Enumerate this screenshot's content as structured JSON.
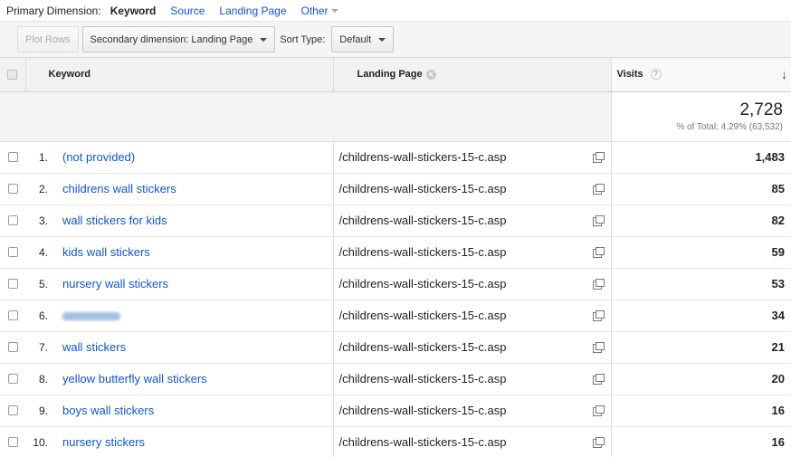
{
  "primary_dimension": {
    "label": "Primary Dimension:",
    "items": [
      {
        "label": "Keyword",
        "active": true
      },
      {
        "label": "Source",
        "active": false
      },
      {
        "label": "Landing Page",
        "active": false
      },
      {
        "label": "Other",
        "active": false
      }
    ]
  },
  "toolbar": {
    "plot_rows": "Plot Rows",
    "secondary_dimension": "Secondary dimension: Landing Page",
    "sort_type_label": "Sort Type:",
    "sort_type_value": "Default"
  },
  "table": {
    "headers": {
      "keyword": "Keyword",
      "landing_page": "Landing Page",
      "visits": "Visits"
    },
    "total": {
      "value": "2,728",
      "pct": "% of Total: 4.29% (63,532)"
    },
    "rows": [
      {
        "idx": "1.",
        "keyword": "(not provided)",
        "landing": "/childrens-wall-stickers-15-c.asp",
        "visits": "1,483"
      },
      {
        "idx": "2.",
        "keyword": "childrens wall stickers",
        "landing": "/childrens-wall-stickers-15-c.asp",
        "visits": "85"
      },
      {
        "idx": "3.",
        "keyword": "wall stickers for kids",
        "landing": "/childrens-wall-stickers-15-c.asp",
        "visits": "82"
      },
      {
        "idx": "4.",
        "keyword": "kids wall stickers",
        "landing": "/childrens-wall-stickers-15-c.asp",
        "visits": "59"
      },
      {
        "idx": "5.",
        "keyword": "nursery wall stickers",
        "landing": "/childrens-wall-stickers-15-c.asp",
        "visits": "53"
      },
      {
        "idx": "6.",
        "keyword": "",
        "landing": "/childrens-wall-stickers-15-c.asp",
        "visits": "34"
      },
      {
        "idx": "7.",
        "keyword": "wall stickers",
        "landing": "/childrens-wall-stickers-15-c.asp",
        "visits": "21"
      },
      {
        "idx": "8.",
        "keyword": "yellow butterfly wall stickers",
        "landing": "/childrens-wall-stickers-15-c.asp",
        "visits": "20"
      },
      {
        "idx": "9.",
        "keyword": "boys wall stickers",
        "landing": "/childrens-wall-stickers-15-c.asp",
        "visits": "16"
      },
      {
        "idx": "10.",
        "keyword": "nursery stickers",
        "landing": "/childrens-wall-stickers-15-c.asp",
        "visits": "16"
      }
    ]
  },
  "icons": {
    "remove_dimension": "remove-icon",
    "visits_help": "help-icon",
    "sort": "sort-down-arrow-icon",
    "landing_link": "external-link-icon"
  },
  "colors": {
    "link": "#1155cc",
    "header_bg": "#f1f1f1",
    "toolbar_bg": "#f5f5f5"
  }
}
